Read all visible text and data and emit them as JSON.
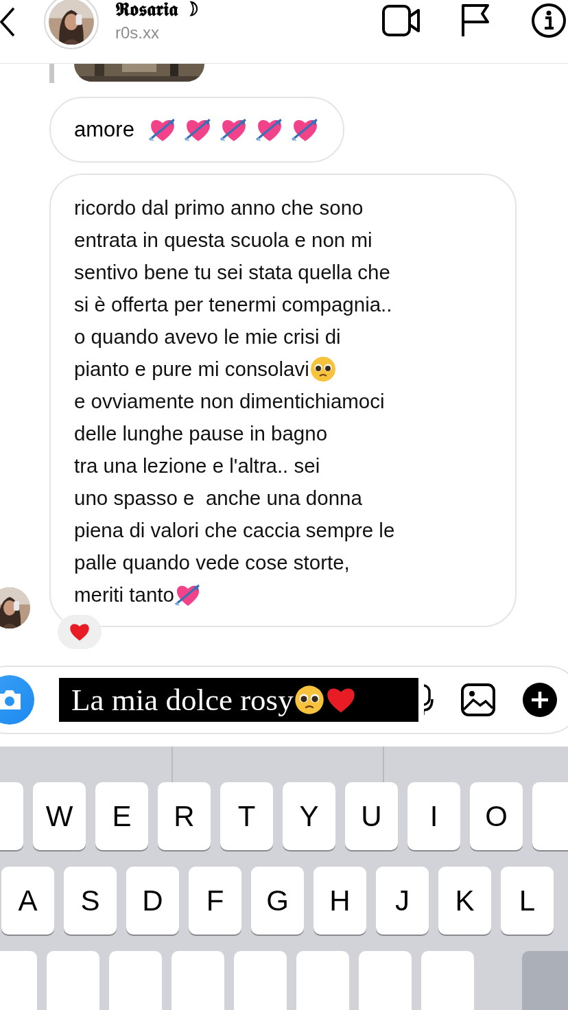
{
  "header": {
    "name": "𝕽𝖔𝖘𝖆𝖗𝖎𝖆 ☽",
    "username": "r0s.xx"
  },
  "messages": [
    {
      "kind": "reply_picture"
    },
    {
      "kind": "text",
      "text": "amore",
      "emojis": [
        {
          "kind": "cupid_heart"
        },
        {
          "kind": "cupid_heart"
        },
        {
          "kind": "cupid_heart"
        },
        {
          "kind": "cupid_heart"
        },
        {
          "kind": "cupid_heart"
        }
      ]
    },
    {
      "kind": "paragraphs",
      "avatar": true,
      "reaction": {
        "kind": "red_heart"
      },
      "paragraphs": [
        {
          "text": "ricordo dal primo anno che sono\nentrata in questa scuola e non mi\nsentivo bene tu sei stata quella che\nsi è offerta per tenermi compagnia..\no quando avevo le mie crisi di\npianto e pure mi consolavi",
          "emoji": {
            "kind": "pleading"
          }
        },
        {
          "text": "e ovviamente non dimentichiamoci\ndelle lunghe pause in bagno\ntra una lezione e l'altra.. sei\nuno spasso e  anche una donna\npiena di valori che caccia sempre le\npalle quando vede cose storte,\nmeriti tanto",
          "emoji": {
            "kind": "cupid_heart"
          }
        }
      ]
    }
  ],
  "caption": {
    "text": "La mia dolce rosy",
    "emojis": [
      {
        "kind": "pleading"
      },
      {
        "kind": "red_heart"
      }
    ]
  },
  "keyboard": {
    "rows": [
      {
        "edge_keys": true,
        "keys": [
          "W",
          "E",
          "R",
          "T",
          "Y",
          "U",
          "I",
          "O"
        ]
      },
      {
        "edge_keys": false,
        "keys": [
          "A",
          "S",
          "D",
          "F",
          "G",
          "H",
          "J",
          "K",
          "L"
        ]
      }
    ]
  }
}
